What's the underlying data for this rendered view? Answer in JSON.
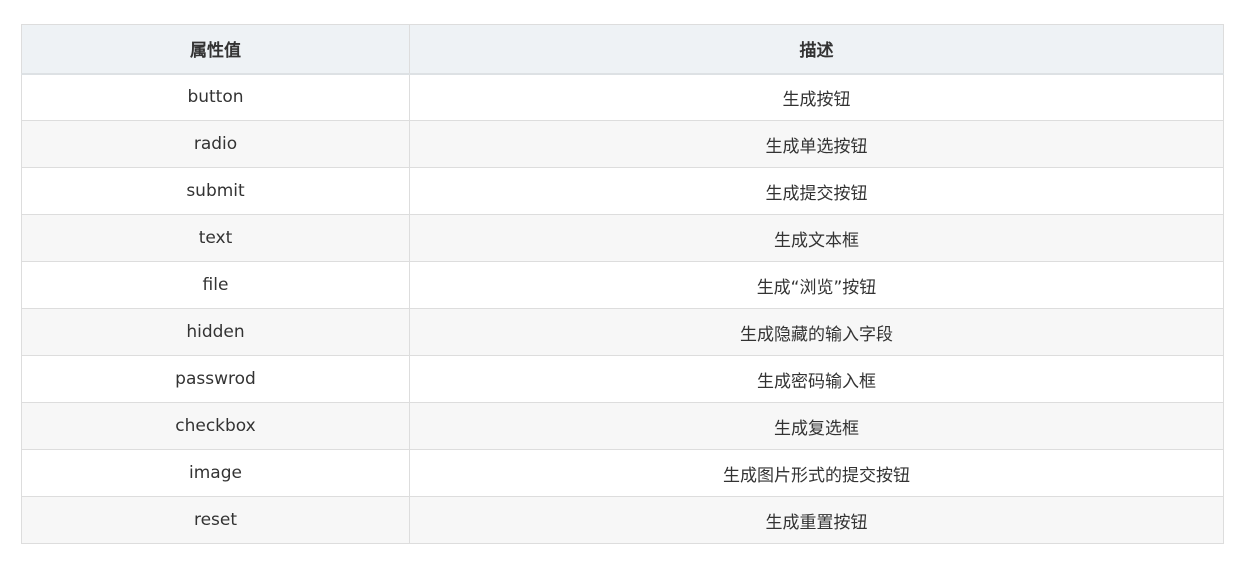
{
  "table": {
    "headers": [
      "属性值",
      "描述"
    ],
    "rows": [
      {
        "value": "button",
        "desc": "生成按钮"
      },
      {
        "value": "radio",
        "desc": "生成单选按钮"
      },
      {
        "value": "submit",
        "desc": "生成提交按钮"
      },
      {
        "value": "text",
        "desc": "生成文本框"
      },
      {
        "value": "file",
        "desc": "生成“浏览”按钮"
      },
      {
        "value": "hidden",
        "desc": "生成隐藏的输入字段"
      },
      {
        "value": "passwrod",
        "desc": "生成密码输入框"
      },
      {
        "value": "checkbox",
        "desc": "生成复选框"
      },
      {
        "value": "image",
        "desc": "生成图片形式的提交按钮"
      },
      {
        "value": "reset",
        "desc": "生成重置按钮"
      }
    ]
  }
}
